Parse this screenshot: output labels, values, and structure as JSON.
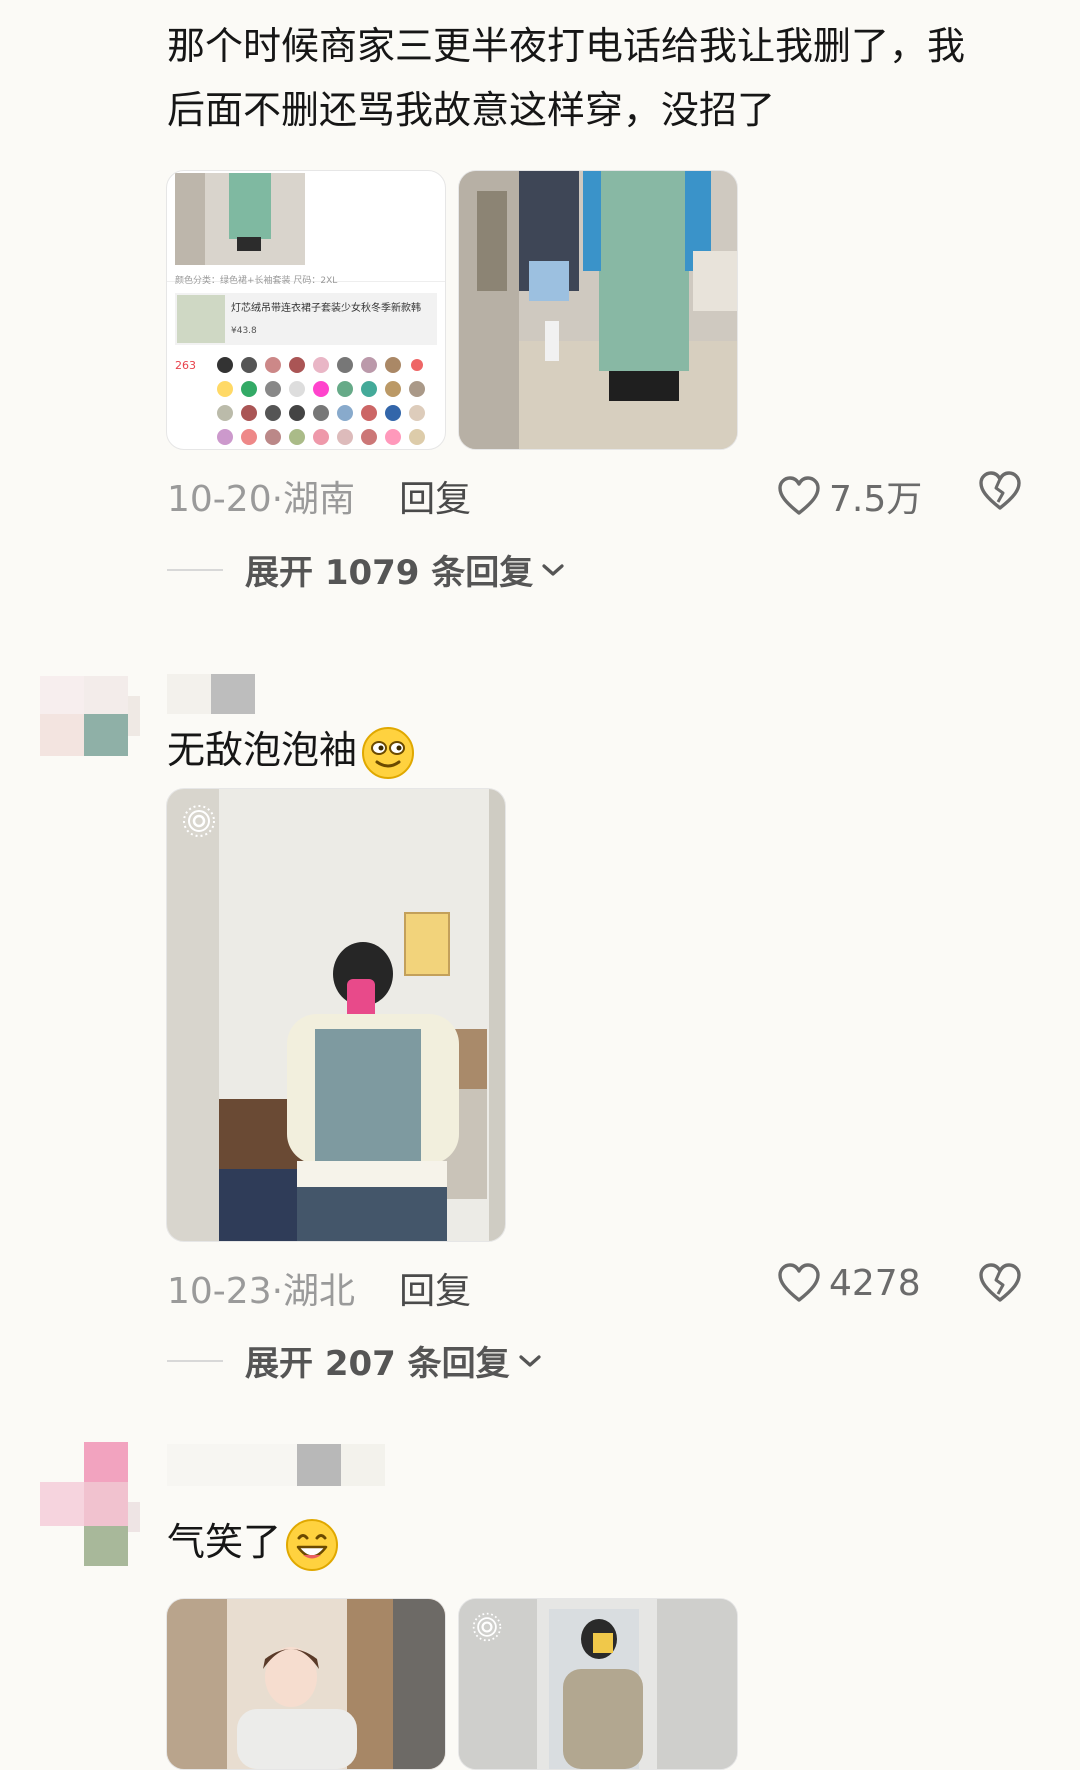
{
  "comments": [
    {
      "text_line1": "那个时候商家三更半夜打电话给我让我删了，我",
      "text_line2": "后面不删还骂我故意这样穿，没招了",
      "screenshot": {
        "spec": "颜色分类：绿色裙+长袖套装 尺码：2XL",
        "product_title": "灯芯绒吊带连衣裙子套装少女秋冬季新款韩",
        "price": "¥43.8",
        "likes": "263"
      },
      "date_location": "10-20·湖南",
      "reply_label": "回复",
      "likes": "7.5万",
      "expand_label": "展开 1079 条回复"
    },
    {
      "text": "无敌泡泡袖",
      "emoji": "smirk-emoji",
      "date_location": "10-23·湖北",
      "reply_label": "回复",
      "likes": "4278",
      "expand_label": "展开 207 条回复"
    },
    {
      "text": "气笑了",
      "emoji": "grin-emoji"
    }
  ],
  "colors": {
    "background": "#fbfaf6",
    "text": "#161616",
    "meta": "#9a9a9a",
    "accent_like": "#e8424b"
  },
  "icons": [
    "heart-icon",
    "broken-heart-icon",
    "chevron-down-icon",
    "live-photo-icon"
  ]
}
